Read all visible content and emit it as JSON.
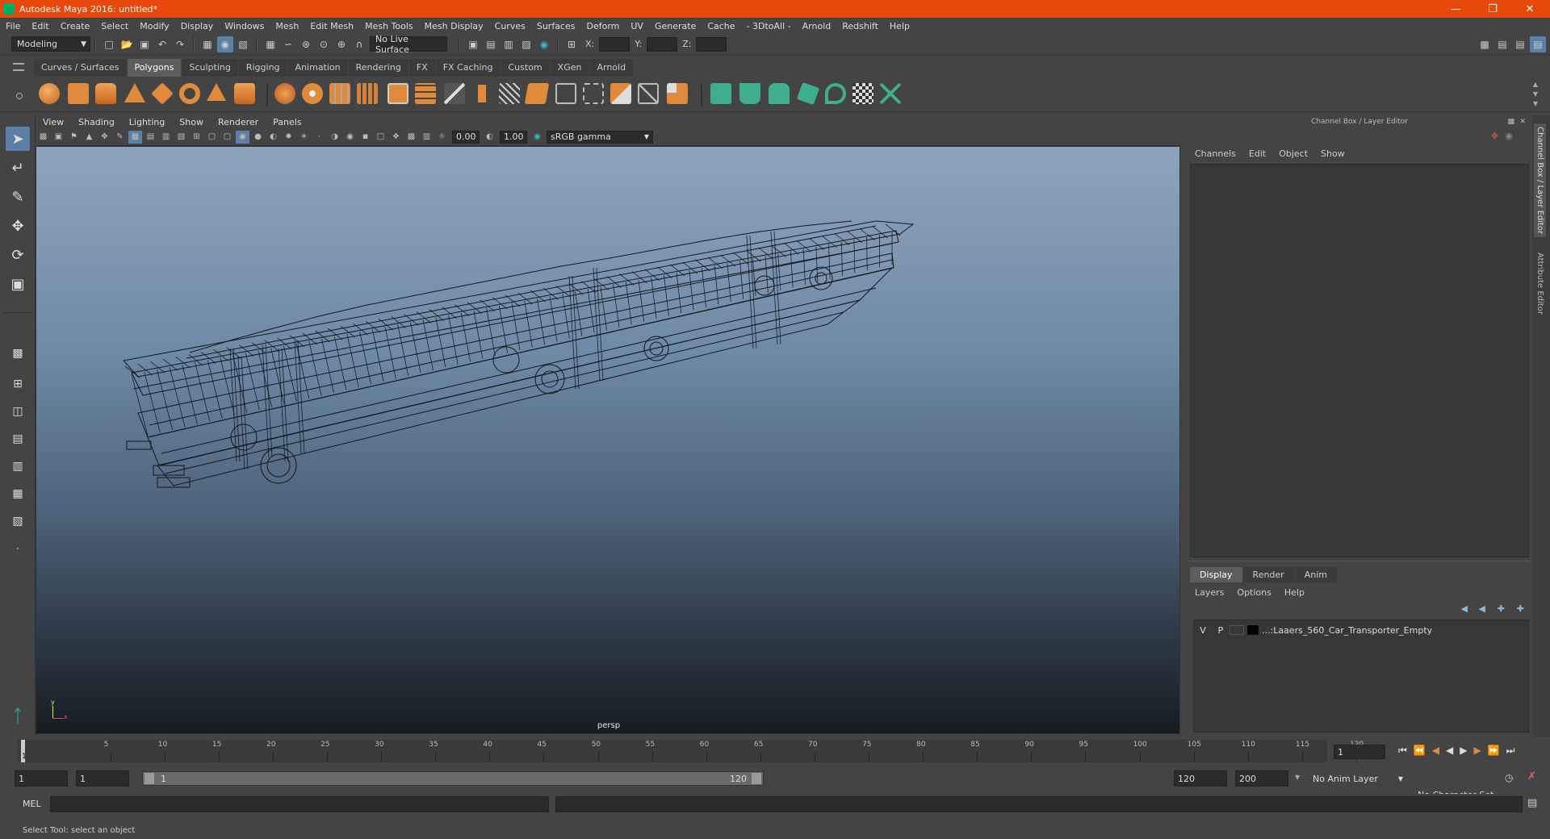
{
  "window": {
    "title": "Autodesk Maya 2016: untitled*"
  },
  "menubar": [
    "File",
    "Edit",
    "Create",
    "Select",
    "Modify",
    "Display",
    "Windows",
    "Mesh",
    "Edit Mesh",
    "Mesh Tools",
    "Mesh Display",
    "Curves",
    "Surfaces",
    "Deform",
    "UV",
    "Generate",
    "Cache",
    "- 3DtoAll -",
    "Arnold",
    "Redshift",
    "Help"
  ],
  "statusline": {
    "mode": "Modeling",
    "live_surface": "No Live Surface",
    "x_label": "X:",
    "y_label": "Y:",
    "z_label": "Z:"
  },
  "shelf": {
    "tabs": [
      "Curves / Surfaces",
      "Polygons",
      "Sculpting",
      "Rigging",
      "Animation",
      "Rendering",
      "FX",
      "FX Caching",
      "Custom",
      "XGen",
      "Arnold"
    ],
    "active_tab": "Polygons"
  },
  "viewport": {
    "menu": [
      "View",
      "Shading",
      "Lighting",
      "Show",
      "Renderer",
      "Panels"
    ],
    "exposure": "0.00",
    "gamma": "1.00",
    "color_space": "sRGB gamma",
    "camera_label": "persp"
  },
  "channel_box": {
    "title": "Channel Box / Layer Editor",
    "menu": [
      "Channels",
      "Edit",
      "Object",
      "Show"
    ],
    "side_tab_1": "Channel Box / Layer Editor",
    "side_tab_2": "Attribute Editor"
  },
  "layer_editor": {
    "tabs": [
      "Display",
      "Render",
      "Anim"
    ],
    "active_tab": "Display",
    "menu": [
      "Layers",
      "Options",
      "Help"
    ],
    "layers": [
      {
        "v": "V",
        "p": "P",
        "name": "...:Laaers_560_Car_Transporter_Empty"
      }
    ]
  },
  "timeline": {
    "ticks": [
      "5",
      "10",
      "15",
      "20",
      "25",
      "30",
      "35",
      "40",
      "45",
      "50",
      "55",
      "60",
      "65",
      "70",
      "75",
      "80",
      "85",
      "90",
      "95",
      "100",
      "105",
      "110",
      "115",
      "120"
    ],
    "start_marker": "1",
    "current_frame": "1"
  },
  "range": {
    "start": "1",
    "playback_start": "1",
    "slider_start": "1",
    "slider_end": "120",
    "playback_end": "120",
    "end": "200",
    "anim_layer": "No Anim Layer",
    "character_set": "No Character Set"
  },
  "command_line": {
    "label": "MEL"
  },
  "help_line": {
    "text": "Select Tool: select an object"
  },
  "colors": {
    "titlebar": "#e8480c",
    "panel": "#444444",
    "dark_field": "#2b2b2b",
    "shelf_orange": "#e08a3c",
    "shelf_green": "#3fae8e"
  }
}
